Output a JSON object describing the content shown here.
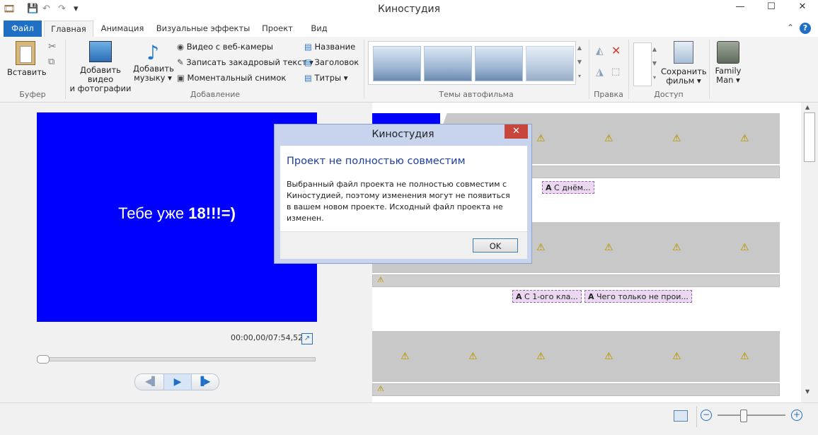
{
  "window": {
    "title": "Киностудия",
    "minimize": "—",
    "maximize": "☐",
    "close": "✕"
  },
  "qat": {
    "save": "💾",
    "undo": "↶",
    "redo": "↷",
    "more": "▾",
    "app_icon": "🎞"
  },
  "tabs": [
    {
      "label": "Файл"
    },
    {
      "label": "Главная"
    },
    {
      "label": "Анимация"
    },
    {
      "label": "Визуальные эффекты"
    },
    {
      "label": "Проект"
    },
    {
      "label": "Вид"
    }
  ],
  "ribbon": {
    "clipboard": {
      "paste": "Вставить",
      "group": "Буфер"
    },
    "add": {
      "add_video_1": "Добавить видео",
      "add_video_2": "и фотографии",
      "add_music_1": "Добавить",
      "add_music_2": "музыку",
      "webcam": "Видео с веб-камеры",
      "narration": "Записать закадровый текст",
      "snapshot": "Моментальный снимок",
      "title": "Название",
      "caption": "Заголовок",
      "credits": "Титры",
      "group": "Добавление"
    },
    "themes": {
      "group": "Темы автофильма"
    },
    "edit": {
      "group": "Правка"
    },
    "share": {
      "group": "Доступ",
      "save_1": "Сохранить",
      "save_2": "фильм"
    },
    "account": {
      "name_1": "Family",
      "name_2": "Man"
    }
  },
  "preview": {
    "text_normal": "Тебе уже ",
    "text_bold": "18!!!=)",
    "timecode": "00:00,00/07:54,52",
    "progress": 0.0
  },
  "storyboard": {
    "captions": [
      "С днём...",
      "С 1-ого кла...",
      "Чего только не прои..."
    ]
  },
  "status": {
    "zoom_level": 0.38
  },
  "dialog": {
    "title": "Киностудия",
    "heading": "Проект не полностью совместим",
    "message": "Выбранный файл проекта не полностью совместим с Киностудией, поэтому изменения могут не появиться в вашем новом проекте. Исходный файл проекта не изменен.",
    "ok": "OK"
  }
}
